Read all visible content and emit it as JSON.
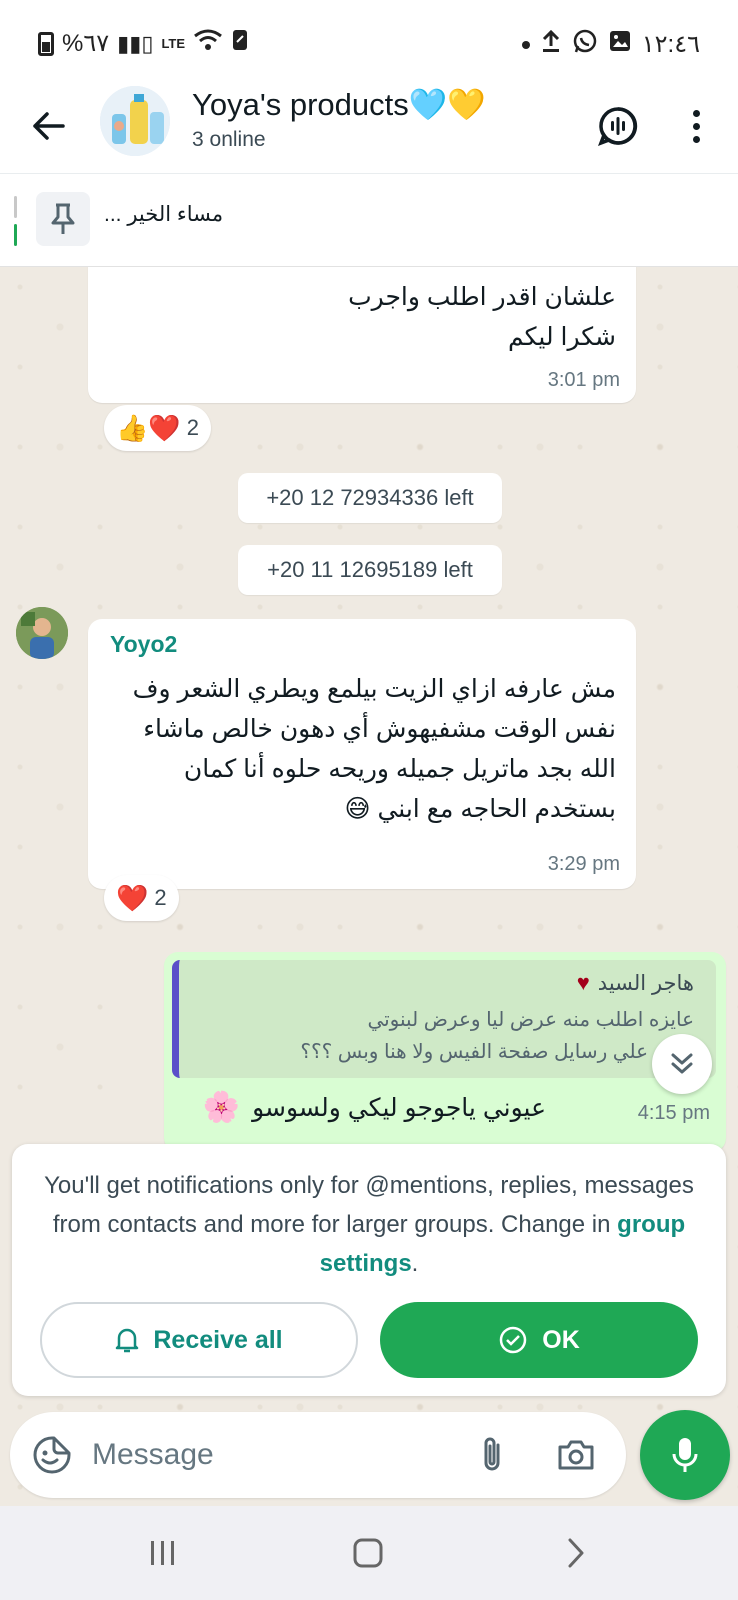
{
  "status_bar": {
    "battery_text": "%٦٧",
    "network": "LTE",
    "time": "١٢:٤٦"
  },
  "header": {
    "title": "Yoya's products🩵💛",
    "subtitle": "3 online"
  },
  "pinned": {
    "text": "مساء الخير ..."
  },
  "messages": [
    {
      "lines": [
        "علشان اقدر اطلب واجرب",
        "شكرا ليكم"
      ],
      "time": "3:01 pm",
      "reactions": {
        "emojis": "👍❤️",
        "count": "2"
      }
    },
    {
      "sender": "Yoyo2",
      "lines": [
        "مش عارفه ازاي الزيت بيلمع ويطري الشعر وف",
        "نفس الوقت مشفيهوش أي دهون خالص ماشاء",
        "الله بجد ماتريل جميله وريحه حلوه أنا كمان",
        "بستخدم الحاجه مع ابني 😅"
      ],
      "time": "3:29 pm",
      "reactions": {
        "emojis": "❤️",
        "count": "2"
      }
    }
  ],
  "system": [
    "+20 12 72934336 left",
    "+20 11 12695189 left"
  ],
  "outgoing": {
    "quote_name": "هاجر السيد",
    "quote_lines": [
      "عايزه اطلب منه عرض ليا وعرض لبنوتي",
      "أبعت علي رسايل صفحة الفيس ولا هنا وبس ؟؟؟"
    ],
    "text": "عيوني ياجوجو ليكي ولسوسو",
    "emoji": "🌸",
    "time": "4:15 pm"
  },
  "notice": {
    "text": "You'll get notifications only for @mentions, replies, messages from contacts and more for larger groups. Change in",
    "link": "group settings",
    "receive_label": "Receive all",
    "ok_label": "OK"
  },
  "composer": {
    "placeholder": "Message"
  },
  "icons": {
    "back": "arrow-left-icon",
    "call": "voice-chat-icon",
    "menu": "more-vert-icon",
    "pin": "pin-icon",
    "sticker": "sticker-icon",
    "attach": "paperclip-icon",
    "camera": "camera-icon",
    "mic": "mic-icon",
    "bell": "bell-icon",
    "check": "check-circle-icon",
    "scroll": "double-chevron-down-icon"
  },
  "colors": {
    "accent": "#1fa855",
    "link": "#128c7e",
    "outgoing_bubble": "#d9fdd3",
    "quote_bar": "#5b4fc9",
    "chat_bg": "#efeae2"
  }
}
